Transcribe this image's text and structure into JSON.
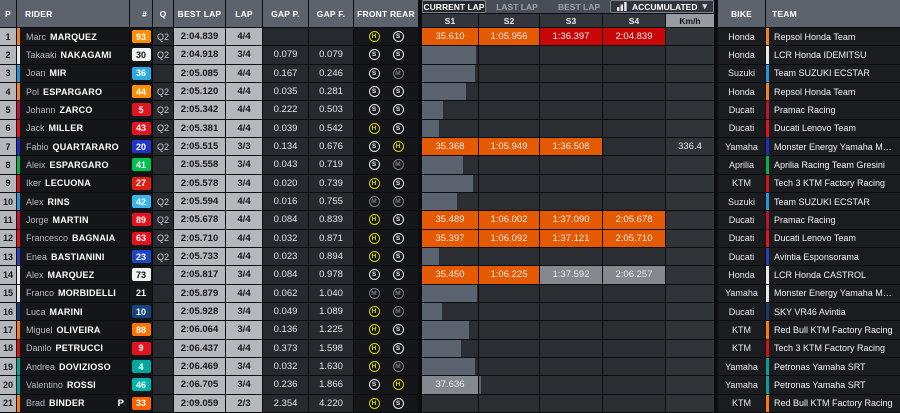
{
  "header": {
    "columns": {
      "p": "P",
      "rider": "RIDER",
      "num": "#",
      "q": "Q",
      "best_lap": "BEST LAP",
      "lap": "LAP",
      "gap_p": "GAP P.",
      "gap_f": "GAP F.",
      "front_rear": "FRONT REAR",
      "bike": "BIKE",
      "team": "TEAM"
    },
    "tabs": [
      {
        "label": "CURRENT LAP",
        "active": true
      },
      {
        "label": "LAST LAP",
        "active": false
      },
      {
        "label": "BEST LAP",
        "active": false
      }
    ],
    "dropdown": {
      "label": "ACCUMULATED",
      "icon": "accumulated-chart-icon",
      "chevron": "▾"
    },
    "sectors": [
      "S1",
      "S2",
      "S3",
      "S4"
    ],
    "speed": "Km/h"
  },
  "colors": {
    "sector_overall_best": "#c90707",
    "sector_personal_best": "#e55a00",
    "sector_neutral": "#84898f",
    "progress_bar": "#5b6370",
    "tyre_hard": "#d9d606",
    "tyre_soft": "#edeff1",
    "tyre_medium": "#787e86"
  },
  "riders": [
    {
      "pos": 1,
      "first": "Marc",
      "last": "MARQUEZ",
      "num": "93",
      "num_bg": "#ff8e00",
      "num_fg": "#ffffff",
      "stripe": "#f58220",
      "q": "Q2",
      "best": "2:04.839",
      "lap": "4/4",
      "gap_p": "",
      "gap_f": "",
      "front": "H",
      "rear": "S",
      "pit": false,
      "sectors": [
        {
          "t": "35.610",
          "c": "orange",
          "bar": 0
        },
        {
          "t": "1:05.956",
          "c": "orange",
          "bar": 0
        },
        {
          "t": "1:36.397",
          "c": "red",
          "bar": 0
        },
        {
          "t": "2:04.839",
          "c": "red",
          "bar": 0
        }
      ],
      "kmh": "",
      "bike": "Honda",
      "team": "Repsol Honda Team"
    },
    {
      "pos": 2,
      "first": "Takaaki",
      "last": "NAKAGAMI",
      "num": "30",
      "num_bg": "#f2f3f4",
      "num_fg": "#111111",
      "stripe": "#e9eaec",
      "q": "Q2",
      "best": "2:04.918",
      "lap": "3/4",
      "gap_p": "0.079",
      "gap_f": "0.079",
      "front": "S",
      "rear": "S",
      "pit": false,
      "sectors": [
        {
          "t": "",
          "c": "",
          "bar": 97
        },
        {
          "t": "",
          "c": "",
          "bar": 0
        },
        {
          "t": "",
          "c": "",
          "bar": 0
        },
        {
          "t": "",
          "c": "",
          "bar": 0
        }
      ],
      "kmh": "",
      "bike": "Honda",
      "team": "LCR Honda IDEMITSU"
    },
    {
      "pos": 3,
      "first": "Joan",
      "last": "MIR",
      "num": "36",
      "num_bg": "#2babe1",
      "num_fg": "#ffffff",
      "stripe": "#1e98d8",
      "q": "",
      "best": "2:05.085",
      "lap": "4/4",
      "gap_p": "0.167",
      "gap_f": "0.246",
      "front": "S",
      "rear": "M",
      "pit": false,
      "sectors": [
        {
          "t": "",
          "c": "",
          "bar": 95
        },
        {
          "t": "",
          "c": "",
          "bar": 0
        },
        {
          "t": "",
          "c": "",
          "bar": 0
        },
        {
          "t": "",
          "c": "",
          "bar": 0
        }
      ],
      "kmh": "",
      "bike": "Suzuki",
      "team": "Team SUZUKI ECSTAR"
    },
    {
      "pos": 4,
      "first": "Pol",
      "last": "ESPARGARO",
      "num": "44",
      "num_bg": "#ff8e00",
      "num_fg": "#ffffff",
      "stripe": "#f58220",
      "q": "Q2",
      "best": "2:05.120",
      "lap": "4/4",
      "gap_p": "0.035",
      "gap_f": "0.281",
      "front": "S",
      "rear": "S",
      "pit": false,
      "sectors": [
        {
          "t": "",
          "c": "",
          "bar": 78
        },
        {
          "t": "",
          "c": "",
          "bar": 0
        },
        {
          "t": "",
          "c": "",
          "bar": 0
        },
        {
          "t": "",
          "c": "",
          "bar": 0
        }
      ],
      "kmh": "",
      "bike": "Honda",
      "team": "Repsol Honda Team"
    },
    {
      "pos": 5,
      "first": "Johann",
      "last": "ZARCO",
      "num": "5",
      "num_bg": "#e11420",
      "num_fg": "#ffffff",
      "stripe": "#c01137",
      "q": "Q2",
      "best": "2:05.342",
      "lap": "4/4",
      "gap_p": "0.222",
      "gap_f": "0.503",
      "front": "S",
      "rear": "S",
      "pit": false,
      "sectors": [
        {
          "t": "",
          "c": "",
          "bar": 38
        },
        {
          "t": "",
          "c": "",
          "bar": 0
        },
        {
          "t": "",
          "c": "",
          "bar": 0
        },
        {
          "t": "",
          "c": "",
          "bar": 0
        }
      ],
      "kmh": "",
      "bike": "Ducati",
      "team": "Pramac Racing"
    },
    {
      "pos": 6,
      "first": "Jack",
      "last": "MILLER",
      "num": "43",
      "num_bg": "#e11420",
      "num_fg": "#ffffff",
      "stripe": "#e8131c",
      "q": "Q2",
      "best": "2:05.381",
      "lap": "4/4",
      "gap_p": "0.039",
      "gap_f": "0.542",
      "front": "H",
      "rear": "S",
      "pit": false,
      "sectors": [
        {
          "t": "",
          "c": "",
          "bar": 31
        },
        {
          "t": "",
          "c": "",
          "bar": 0
        },
        {
          "t": "",
          "c": "",
          "bar": 0
        },
        {
          "t": "",
          "c": "",
          "bar": 0
        }
      ],
      "kmh": "",
      "bike": "Ducati",
      "team": "Ducati Lenovo Team"
    },
    {
      "pos": 7,
      "first": "Fabio",
      "last": "QUARTARARO",
      "num": "20",
      "num_bg": "#2135cd",
      "num_fg": "#ffffff",
      "stripe": "#1c2dbf",
      "q": "Q2",
      "best": "2:05.515",
      "lap": "3/3",
      "gap_p": "0.134",
      "gap_f": "0.676",
      "front": "S",
      "rear": "H",
      "pit": false,
      "sectors": [
        {
          "t": "35.368",
          "c": "orange",
          "bar": 0
        },
        {
          "t": "1:05.949",
          "c": "orange",
          "bar": 0
        },
        {
          "t": "1:36.508",
          "c": "orange",
          "bar": 0
        },
        {
          "t": "",
          "c": "",
          "bar": 0
        }
      ],
      "kmh": "336.4",
      "bike": "Yamaha",
      "team": "Monster Energy Yamaha Moto..."
    },
    {
      "pos": 8,
      "first": "Aleix",
      "last": "ESPARGARO",
      "num": "41",
      "num_bg": "#00c24e",
      "num_fg": "#ffffff",
      "stripe": "#00b14f",
      "q": "",
      "best": "2:05.558",
      "lap": "3/4",
      "gap_p": "0.043",
      "gap_f": "0.719",
      "front": "S",
      "rear": "M",
      "pit": false,
      "sectors": [
        {
          "t": "",
          "c": "",
          "bar": 73
        },
        {
          "t": "",
          "c": "",
          "bar": 0
        },
        {
          "t": "",
          "c": "",
          "bar": 0
        },
        {
          "t": "",
          "c": "",
          "bar": 0
        }
      ],
      "kmh": "",
      "bike": "Aprilia",
      "team": "Aprilia Racing Team Gresini"
    },
    {
      "pos": 9,
      "first": "Iker",
      "last": "LECUONA",
      "num": "27",
      "num_bg": "#dd1e10",
      "num_fg": "#ffffff",
      "stripe": "#d51317",
      "q": "",
      "best": "2:05.578",
      "lap": "3/4",
      "gap_p": "0.020",
      "gap_f": "0.739",
      "front": "H",
      "rear": "S",
      "pit": false,
      "sectors": [
        {
          "t": "",
          "c": "",
          "bar": 91
        },
        {
          "t": "",
          "c": "",
          "bar": 0
        },
        {
          "t": "",
          "c": "",
          "bar": 0
        },
        {
          "t": "",
          "c": "",
          "bar": 0
        }
      ],
      "kmh": "",
      "bike": "KTM",
      "team": "Tech 3 KTM Factory Racing"
    },
    {
      "pos": 10,
      "first": "Alex",
      "last": "RINS",
      "num": "42",
      "num_bg": "#35b7eb",
      "num_fg": "#ffffff",
      "stripe": "#1e98d8",
      "q": "Q2",
      "best": "2:05.594",
      "lap": "4/4",
      "gap_p": "0.016",
      "gap_f": "0.755",
      "front": "M",
      "rear": "M",
      "pit": false,
      "sectors": [
        {
          "t": "",
          "c": "",
          "bar": 63
        },
        {
          "t": "",
          "c": "",
          "bar": 0
        },
        {
          "t": "",
          "c": "",
          "bar": 0
        },
        {
          "t": "",
          "c": "",
          "bar": 0
        }
      ],
      "kmh": "",
      "bike": "Suzuki",
      "team": "Team SUZUKI ECSTAR"
    },
    {
      "pos": 11,
      "first": "Jorge",
      "last": "MARTIN",
      "num": "89",
      "num_bg": "#e8101e",
      "num_fg": "#ffffff",
      "stripe": "#c01137",
      "q": "Q2",
      "best": "2:05.678",
      "lap": "4/4",
      "gap_p": "0.084",
      "gap_f": "0.839",
      "front": "H",
      "rear": "S",
      "pit": false,
      "sectors": [
        {
          "t": "35.489",
          "c": "orange",
          "bar": 0
        },
        {
          "t": "1:06.002",
          "c": "orange",
          "bar": 0
        },
        {
          "t": "1:37.090",
          "c": "orange",
          "bar": 0
        },
        {
          "t": "2:05.678",
          "c": "orange",
          "bar": 0
        }
      ],
      "kmh": "",
      "bike": "Ducati",
      "team": "Pramac Racing"
    },
    {
      "pos": 12,
      "first": "Francesco",
      "last": "BAGNAIA",
      "num": "63",
      "num_bg": "#e8101e",
      "num_fg": "#ffffff",
      "stripe": "#e8131c",
      "q": "Q2",
      "best": "2:05.710",
      "lap": "4/4",
      "gap_p": "0.032",
      "gap_f": "0.871",
      "front": "H",
      "rear": "S",
      "pit": false,
      "sectors": [
        {
          "t": "35.397",
          "c": "orange",
          "bar": 0
        },
        {
          "t": "1:06.092",
          "c": "orange",
          "bar": 0
        },
        {
          "t": "1:37.121",
          "c": "orange",
          "bar": 0
        },
        {
          "t": "2:05.710",
          "c": "orange",
          "bar": 0
        }
      ],
      "kmh": "",
      "bike": "Ducati",
      "team": "Ducati Lenovo Team"
    },
    {
      "pos": 13,
      "first": "Enea",
      "last": "BASTIANINI",
      "num": "23",
      "num_bg": "#2046c8",
      "num_fg": "#ffffff",
      "stripe": "#2a3fb8",
      "q": "Q2",
      "best": "2:05.733",
      "lap": "4/4",
      "gap_p": "0.023",
      "gap_f": "0.894",
      "front": "H",
      "rear": "S",
      "pit": false,
      "sectors": [
        {
          "t": "",
          "c": "",
          "bar": 31
        },
        {
          "t": "",
          "c": "",
          "bar": 0
        },
        {
          "t": "",
          "c": "",
          "bar": 0
        },
        {
          "t": "",
          "c": "",
          "bar": 0
        }
      ],
      "kmh": "",
      "bike": "Ducati",
      "team": "Avintia Esponsorama"
    },
    {
      "pos": 14,
      "first": "Alex",
      "last": "MARQUEZ",
      "num": "73",
      "num_bg": "#f2f3f4",
      "num_fg": "#111111",
      "stripe": "#e9eaec",
      "q": "",
      "best": "2:05.817",
      "lap": "3/4",
      "gap_p": "0.084",
      "gap_f": "0.978",
      "front": "S",
      "rear": "S",
      "pit": false,
      "sectors": [
        {
          "t": "35.450",
          "c": "orange",
          "bar": 0
        },
        {
          "t": "1:06.225",
          "c": "orange",
          "bar": 0
        },
        {
          "t": "1:37.592",
          "c": "gray",
          "bar": 0
        },
        {
          "t": "2:06.257",
          "c": "gray",
          "bar": 0
        }
      ],
      "kmh": "",
      "bike": "Honda",
      "team": "LCR Honda CASTROL"
    },
    {
      "pos": 15,
      "first": "Franco",
      "last": "MORBIDELLI",
      "num": "21",
      "num_bg": "",
      "num_fg": "#ffffff",
      "stripe": "#e9eaec",
      "q": "",
      "best": "2:05.879",
      "lap": "4/4",
      "gap_p": "0.062",
      "gap_f": "1.040",
      "front": "M",
      "rear": "M",
      "pit": false,
      "sectors": [
        {
          "t": "",
          "c": "",
          "bar": 99
        },
        {
          "t": "",
          "c": "",
          "bar": 0
        },
        {
          "t": "",
          "c": "",
          "bar": 0
        },
        {
          "t": "",
          "c": "",
          "bar": 0
        }
      ],
      "kmh": "",
      "bike": "Yamaha",
      "team": "Monster Energy Yamaha Moto..."
    },
    {
      "pos": 16,
      "first": "Luca",
      "last": "MARINI",
      "num": "10",
      "num_bg": "#15457f",
      "num_fg": "#ffffff",
      "stripe": "#143d73",
      "q": "",
      "best": "2:05.928",
      "lap": "3/4",
      "gap_p": "0.049",
      "gap_f": "1.089",
      "front": "H",
      "rear": "M",
      "pit": false,
      "sectors": [
        {
          "t": "",
          "c": "",
          "bar": 35
        },
        {
          "t": "",
          "c": "",
          "bar": 0
        },
        {
          "t": "",
          "c": "",
          "bar": 0
        },
        {
          "t": "",
          "c": "",
          "bar": 0
        }
      ],
      "kmh": "",
      "bike": "Ducati",
      "team": "SKY VR46 Avintia"
    },
    {
      "pos": 17,
      "first": "Miguel",
      "last": "OLIVEIRA",
      "num": "88",
      "num_bg": "#ff7300",
      "num_fg": "#ffffff",
      "stripe": "#ff7b08",
      "q": "",
      "best": "2:06.064",
      "lap": "3/4",
      "gap_p": "0.136",
      "gap_f": "1.225",
      "front": "H",
      "rear": "S",
      "pit": false,
      "sectors": [
        {
          "t": "",
          "c": "",
          "bar": 84
        },
        {
          "t": "",
          "c": "",
          "bar": 0
        },
        {
          "t": "",
          "c": "",
          "bar": 0
        },
        {
          "t": "",
          "c": "",
          "bar": 0
        }
      ],
      "kmh": "",
      "bike": "KTM",
      "team": "Red Bull KTM Factory Racing"
    },
    {
      "pos": 18,
      "first": "Danilo",
      "last": "PETRUCCI",
      "num": "9",
      "num_bg": "#e11420",
      "num_fg": "#ffffff",
      "stripe": "#d51317",
      "q": "",
      "best": "2:06.437",
      "lap": "4/4",
      "gap_p": "0.373",
      "gap_f": "1.598",
      "front": "H",
      "rear": "S",
      "pit": false,
      "sectors": [
        {
          "t": "",
          "c": "",
          "bar": 70
        },
        {
          "t": "",
          "c": "",
          "bar": 0
        },
        {
          "t": "",
          "c": "",
          "bar": 0
        },
        {
          "t": "",
          "c": "",
          "bar": 0
        }
      ],
      "kmh": "",
      "bike": "KTM",
      "team": "Tech 3 KTM Factory Racing"
    },
    {
      "pos": 19,
      "first": "Andrea",
      "last": "DOVIZIOSO",
      "num": "4",
      "num_bg": "#00a8a0",
      "num_fg": "#ffffff",
      "stripe": "#00a39b",
      "q": "",
      "best": "2:06.469",
      "lap": "3/4",
      "gap_p": "0.032",
      "gap_f": "1.630",
      "front": "H",
      "rear": "M",
      "pit": false,
      "sectors": [
        {
          "t": "",
          "c": "",
          "bar": 95
        },
        {
          "t": "",
          "c": "",
          "bar": 0
        },
        {
          "t": "",
          "c": "",
          "bar": 0
        },
        {
          "t": "",
          "c": "",
          "bar": 0
        }
      ],
      "kmh": "",
      "bike": "Yamaha",
      "team": "Petronas Yamaha SRT"
    },
    {
      "pos": 20,
      "first": "Valentino",
      "last": "ROSSI",
      "num": "46",
      "num_bg": "#00b3ab",
      "num_fg": "#ffffff",
      "stripe": "#00a39b",
      "q": "",
      "best": "2:06.705",
      "lap": "3/4",
      "gap_p": "0.236",
      "gap_f": "1.866",
      "front": "S",
      "rear": "H",
      "pit": false,
      "sectors": [
        {
          "t": "37.636",
          "c": "gray",
          "bar": 0
        },
        {
          "t": "",
          "c": "",
          "bar": 3
        },
        {
          "t": "",
          "c": "",
          "bar": 0
        },
        {
          "t": "",
          "c": "",
          "bar": 0
        }
      ],
      "kmh": "",
      "bike": "Yamaha",
      "team": "Petronas Yamaha SRT"
    },
    {
      "pos": 21,
      "first": "Brad",
      "last": "BINDER",
      "num": "33",
      "num_bg": "#ff6000",
      "num_fg": "#ffffff",
      "stripe": "#ff7b08",
      "q": "",
      "best": "2:09.059",
      "lap": "2/3",
      "gap_p": "2.354",
      "gap_f": "4.220",
      "front": "H",
      "rear": "S",
      "pit": true,
      "sectors": [
        {
          "t": "",
          "c": "",
          "bar": 0
        },
        {
          "t": "",
          "c": "",
          "bar": 0
        },
        {
          "t": "",
          "c": "",
          "bar": 0
        },
        {
          "t": "",
          "c": "",
          "bar": 0
        }
      ],
      "kmh": "",
      "bike": "KTM",
      "team": "Red Bull KTM Factory Racing"
    }
  ]
}
